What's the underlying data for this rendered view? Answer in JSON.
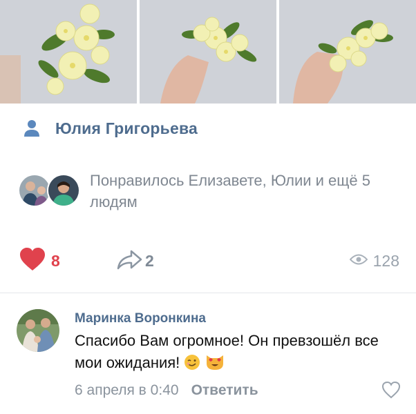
{
  "author": {
    "name": "Юлия Григорьева",
    "icon": "user-icon"
  },
  "likes_summary": {
    "text": "Понравилось Елизавете, Юлии и ещё 5 людям"
  },
  "actions": {
    "likes_count": "8",
    "shares_count": "2",
    "views_count": "128",
    "like_color": "#e0424d"
  },
  "comment": {
    "author": "Маринка Воронкина",
    "text": "Спасибо Вам огромное!  Он превзошёл все мои ожидания!",
    "date": "6 апреля в 0:40",
    "reply_label": "Ответить"
  },
  "colors": {
    "link": "#4e6c8e",
    "muted": "#7f8791"
  }
}
